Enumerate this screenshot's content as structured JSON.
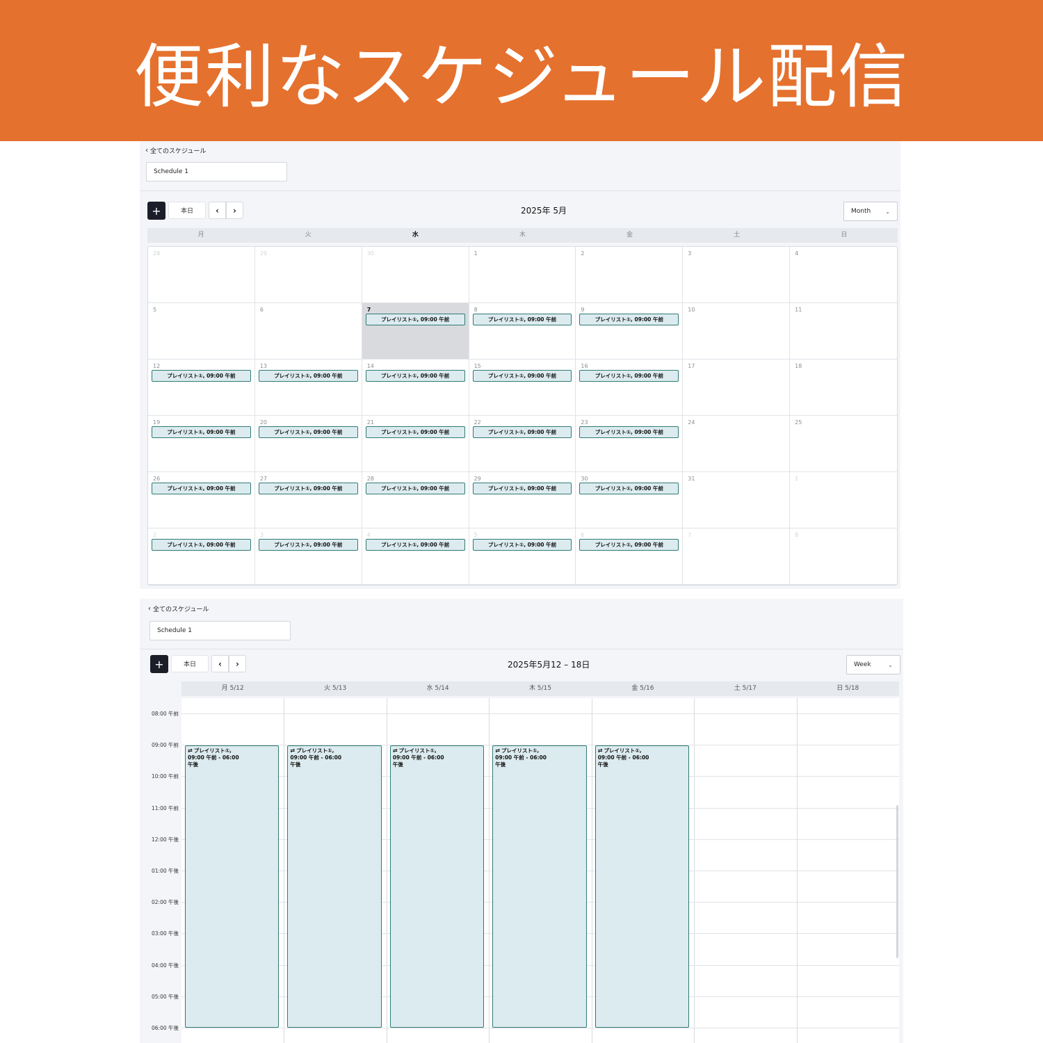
{
  "banner": {
    "title": "便利なスケジュール配信"
  },
  "month_view": {
    "back_label": "全てのスケジュール",
    "schedule_name": "Schedule 1",
    "today_button": "本日",
    "title": "2025年 5月",
    "view_mode": "Month",
    "weekdays": [
      "月",
      "火",
      "水",
      "木",
      "金",
      "土",
      "日"
    ],
    "today_weekday_index": 2,
    "weeks": [
      [
        {
          "d": "28",
          "off": true
        },
        {
          "d": "29",
          "off": true
        },
        {
          "d": "30",
          "off": true
        },
        {
          "d": "1"
        },
        {
          "d": "2"
        },
        {
          "d": "3"
        },
        {
          "d": "4"
        }
      ],
      [
        {
          "d": "5"
        },
        {
          "d": "6"
        },
        {
          "d": "7",
          "today": true,
          "ev": true
        },
        {
          "d": "8",
          "ev": true
        },
        {
          "d": "9",
          "ev": true
        },
        {
          "d": "10"
        },
        {
          "d": "11"
        }
      ],
      [
        {
          "d": "12",
          "ev": true
        },
        {
          "d": "13",
          "ev": true
        },
        {
          "d": "14",
          "ev": true
        },
        {
          "d": "15",
          "ev": true
        },
        {
          "d": "16",
          "ev": true
        },
        {
          "d": "17"
        },
        {
          "d": "18"
        }
      ],
      [
        {
          "d": "19",
          "ev": true
        },
        {
          "d": "20",
          "ev": true
        },
        {
          "d": "21",
          "ev": true
        },
        {
          "d": "22",
          "ev": true
        },
        {
          "d": "23",
          "ev": true
        },
        {
          "d": "24"
        },
        {
          "d": "25"
        }
      ],
      [
        {
          "d": "26",
          "ev": true
        },
        {
          "d": "27",
          "ev": true
        },
        {
          "d": "28",
          "ev": true
        },
        {
          "d": "29",
          "ev": true
        },
        {
          "d": "30",
          "ev": true
        },
        {
          "d": "31"
        },
        {
          "d": "1",
          "off": true
        }
      ],
      [
        {
          "d": "2",
          "off": true,
          "ev": true
        },
        {
          "d": "3",
          "off": true,
          "ev": true
        },
        {
          "d": "4",
          "off": true,
          "ev": true
        },
        {
          "d": "5",
          "off": true,
          "ev": true
        },
        {
          "d": "6",
          "off": true,
          "ev": true
        },
        {
          "d": "7",
          "off": true
        },
        {
          "d": "8",
          "off": true
        }
      ]
    ],
    "event_label": "プレイリスト①, 09:00 午前"
  },
  "week_view": {
    "back_label": "全てのスケジュール",
    "schedule_name": "Schedule 1",
    "today_button": "本日",
    "title": "2025年5月12 – 18日",
    "view_mode": "Week",
    "days": [
      "月 5/12",
      "火 5/13",
      "水 5/14",
      "木 5/15",
      "金 5/16",
      "土 5/17",
      "日 5/18"
    ],
    "times": [
      "08:00 午前",
      "09:00 午前",
      "10:00 午前",
      "11:00 午前",
      "12:00 午後",
      "01:00 午後",
      "02:00 午後",
      "03:00 午後",
      "04:00 午後",
      "05:00 午後",
      "06:00 午後"
    ],
    "event_line1": "プレイリスト①,",
    "event_line2": "09:00 午前 - 06:00",
    "event_line3": "午後",
    "event_days": [
      0,
      1,
      2,
      3,
      4
    ]
  },
  "colors": {
    "banner": "#e5712e",
    "event_bg": "#dcebef",
    "event_border": "#2e7a74",
    "add_button": "#1b1d29"
  },
  "icons": {
    "back": "chevron-left-icon",
    "repeat": "repeat-icon",
    "dropdown": "chevron-down-icon"
  }
}
